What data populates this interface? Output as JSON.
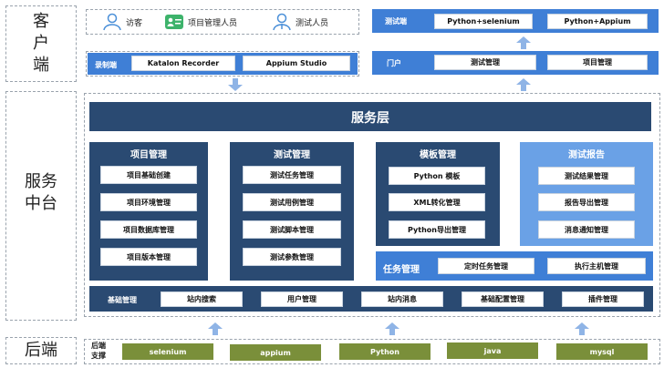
{
  "layers": {
    "client": "客\n户\n端",
    "service": "服务\n中台",
    "backend": "后端"
  },
  "roles": [
    {
      "label": "访客",
      "icon": "user-icon"
    },
    {
      "label": "项目管理人员",
      "icon": "id-card-icon"
    },
    {
      "label": "测试人员",
      "icon": "tester-icon"
    }
  ],
  "test_end": {
    "label": "测试端",
    "items": [
      "Python+selenium",
      "Python+Appium"
    ]
  },
  "record_end": {
    "label": "录制端",
    "items": [
      "Katalon Recorder",
      "Appium Studio"
    ]
  },
  "portal": {
    "label": "门户",
    "items": [
      "测试管理",
      "项目管理"
    ]
  },
  "service_layer": "服务层",
  "columns": [
    {
      "title": "项目管理",
      "items": [
        "项目基础创建",
        "项目环境管理",
        "项目数据库管理",
        "项目版本管理"
      ]
    },
    {
      "title": "测试管理",
      "items": [
        "测试任务管理",
        "测试用例管理",
        "测试脚本管理",
        "测试参数管理"
      ]
    },
    {
      "title": "模板管理",
      "items": [
        "Python 模板",
        "XML转化管理",
        "Python导出管理"
      ]
    },
    {
      "title": "测试报告",
      "items": [
        "测试结果管理",
        "报告导出管理",
        "消息通知管理"
      ]
    }
  ],
  "task_mgmt": {
    "label": "任务管理",
    "items": [
      "定时任务管理",
      "执行主机管理"
    ]
  },
  "base_mgmt": {
    "label": "基础管理",
    "items": [
      "站内搜索",
      "用户管理",
      "站内消息",
      "基础配置管理",
      "插件管理"
    ]
  },
  "backend_support": {
    "label": "后端\n支撑",
    "items": [
      "selenium",
      "appium",
      "Python",
      "java",
      "mysql"
    ]
  },
  "colors": {
    "navy": "#2a4a72",
    "blue": "#3f7fd6",
    "light_blue": "#6aa1e6",
    "olive": "#7a8f3a",
    "arrow": "#8fb4e6"
  }
}
